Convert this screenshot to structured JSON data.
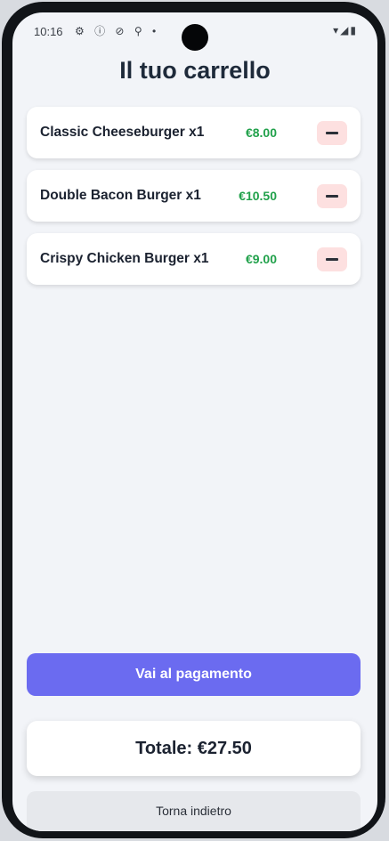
{
  "status_bar": {
    "time": "10:16",
    "left_icons": "⚙ ⓘ ⊘ ⚲ •",
    "right_icons": "▾◢▮"
  },
  "header": {
    "title": "Il tuo carrello"
  },
  "cart": {
    "items": [
      {
        "name": "Classic Cheeseburger x1",
        "price": "€8.00"
      },
      {
        "name": "Double Bacon Burger x1",
        "price": "€10.50"
      },
      {
        "name": "Crispy Chicken Burger x1",
        "price": "€9.00"
      }
    ]
  },
  "actions": {
    "pay_label": "Vai al pagamento",
    "back_label": "Torna indietro"
  },
  "summary": {
    "total_label": "Totale: €27.50"
  },
  "colors": {
    "accent": "#6b6bf0",
    "price": "#21a14b",
    "remove_bg": "#fde0e0",
    "background": "#f2f4f8"
  },
  "icons": {
    "remove": "minus-icon",
    "camera": "camera-icon"
  }
}
